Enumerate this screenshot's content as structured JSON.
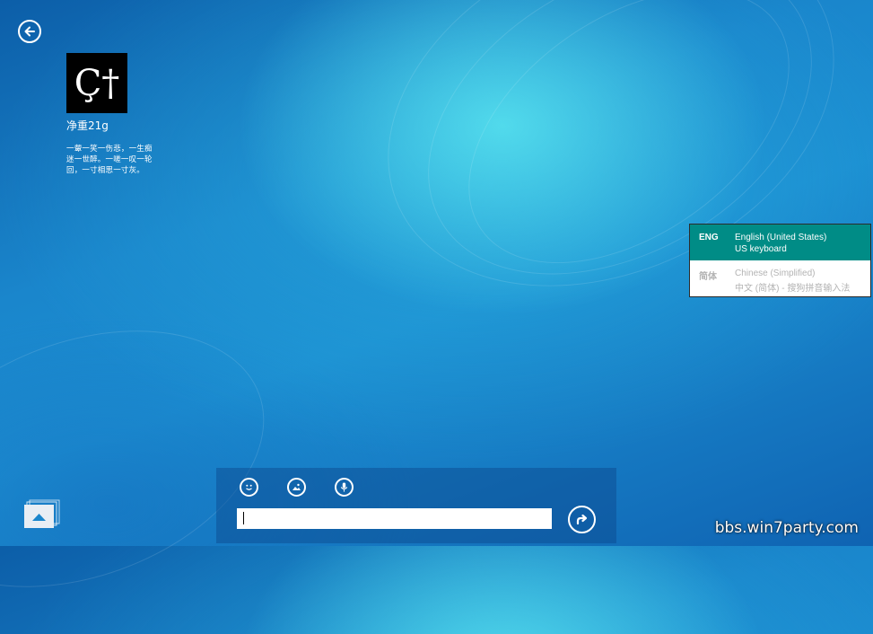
{
  "navigation": {
    "back_icon": "back-arrow-icon"
  },
  "contact": {
    "name": "净重21g",
    "status": "一颦一笑一伤悲，一生痴迷一世醉。一嗟一叹一轮回，一寸相思一寸灰。",
    "avatar_text": "Ç†"
  },
  "language_menu": {
    "items": [
      {
        "code": "ENG",
        "name": "English (United States)",
        "layout": "US keyboard",
        "selected": true
      },
      {
        "code": "简体",
        "name": "Chinese (Simplified)",
        "layout": "中文 (简体) - 搜狗拼音输入法",
        "selected": false
      }
    ]
  },
  "compose": {
    "tools": [
      "emoji-icon",
      "image-icon",
      "microphone-icon"
    ],
    "input_value": "",
    "send_icon": "send-icon"
  },
  "watermark": "bbs.win7party.com",
  "colors": {
    "accent": "#008c86",
    "background": "#1a86cc"
  }
}
